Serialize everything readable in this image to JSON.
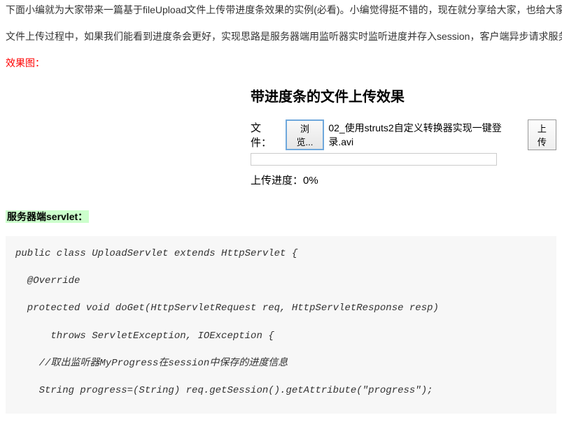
{
  "article": {
    "intro_line1": "下面小编就为大家带来一篇基于fileUpload文件上传带进度条效果的实例(必看)。小编觉得挺不错的，现在就分享给大家，也给大家",
    "intro_line2": "文件上传过程中，如果我们能看到进度条会更好，实现思路是服务器端用监听器实时监听进度并存入session，客户端异步请求服务",
    "section_effect": "效果图：",
    "section_servlet": "服务器端servlet：",
    "code": "public class UploadServlet extends HttpServlet {\n\n  @Override\n\n  protected void doGet(HttpServletRequest req, HttpServletResponse resp)\n\n      throws ServletException, IOException {\n\n    //取出监听器MyProgress在session中保存的进度信息\n\n    String progress=(String) req.getSession().getAttribute(\"progress\");\n"
  },
  "demo": {
    "title": "带进度条的文件上传效果",
    "file_label": "文件：",
    "browse_label": "浏览...",
    "selected_file": "02_使用struts2自定义转换器实现一键登录.avi",
    "upload_label": "上传",
    "progress_label": "上传进度：0%"
  }
}
